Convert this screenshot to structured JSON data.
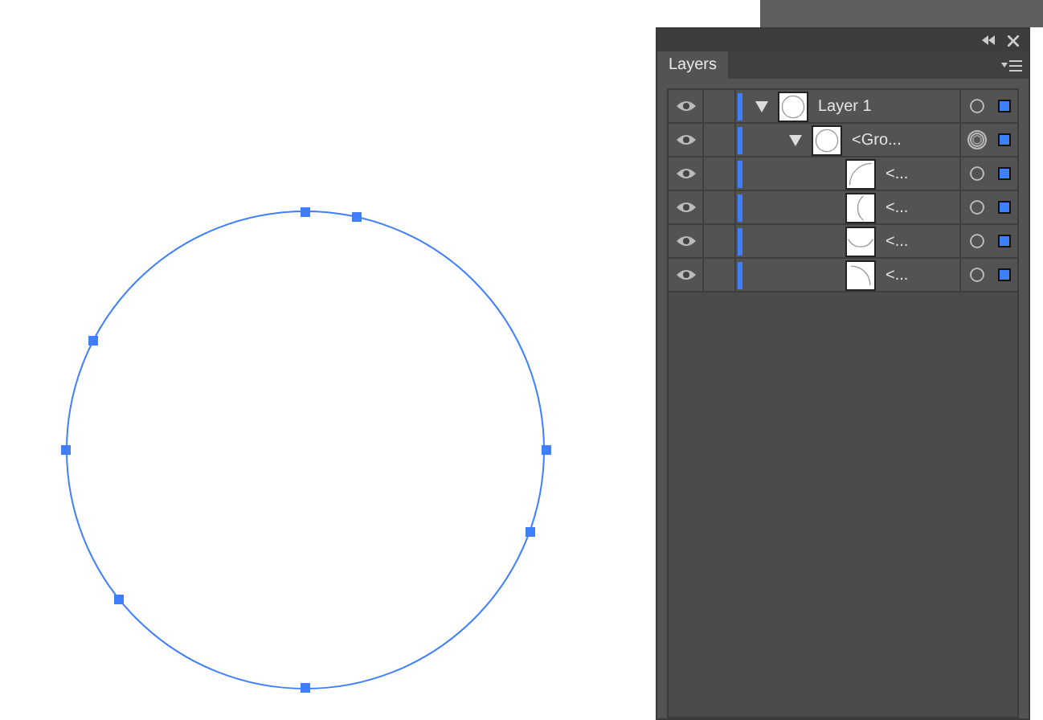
{
  "panel": {
    "tabs": [
      {
        "label": "Layers",
        "selected": true
      }
    ]
  },
  "layers": [
    {
      "name": "Layer 1",
      "visible": true,
      "expanded": true,
      "targeted": false,
      "kind": "circle",
      "children": [
        {
          "name": "<Gro...",
          "visible": true,
          "expanded": true,
          "targeted": true,
          "kind": "circle",
          "children": [
            {
              "name": "<...",
              "visible": true,
              "targeted": false,
              "kind": "arc-nw"
            },
            {
              "name": "<...",
              "visible": true,
              "targeted": false,
              "kind": "arc-w"
            },
            {
              "name": "<...",
              "visible": true,
              "targeted": false,
              "kind": "arc-s"
            },
            {
              "name": "<...",
              "visible": true,
              "targeted": false,
              "kind": "arc-ne"
            }
          ]
        }
      ]
    }
  ]
}
